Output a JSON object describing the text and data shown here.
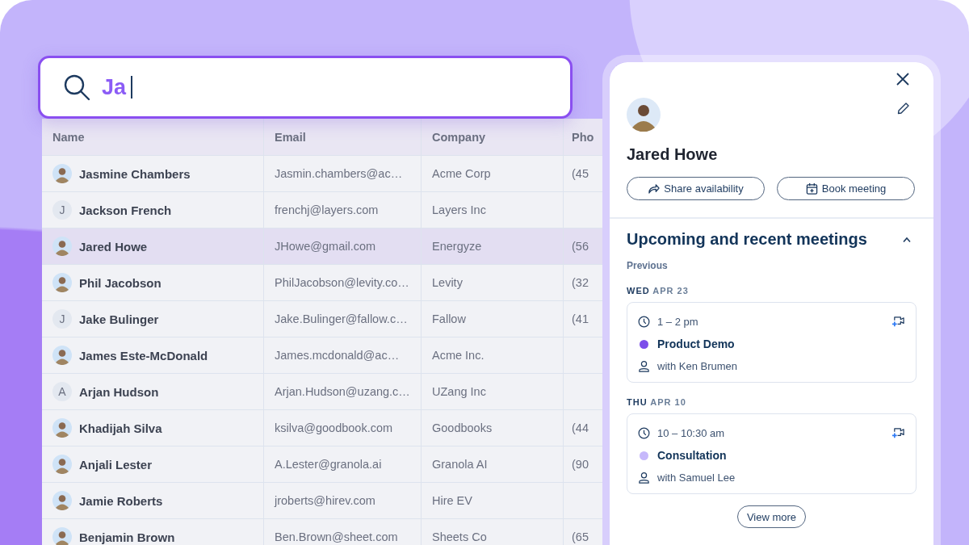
{
  "search": {
    "value": "Ja"
  },
  "table": {
    "columns": [
      "Name",
      "Email",
      "Company",
      "Pho"
    ],
    "rows": [
      {
        "avatar": {
          "kind": "photo"
        },
        "name": "Jasmine Chambers",
        "email": "Jasmin.chambers@ac…",
        "company": "Acme Corp",
        "phone": "(45",
        "selected": false
      },
      {
        "avatar": {
          "kind": "initial",
          "initial": "J"
        },
        "name": "Jackson French",
        "email": "frenchj@layers.com",
        "company": "Layers Inc",
        "selected": false
      },
      {
        "avatar": {
          "kind": "photo"
        },
        "name": "Jared Howe",
        "email": "JHowe@gmail.com",
        "company": "Energyze",
        "phone": "(56",
        "selected": true
      },
      {
        "avatar": {
          "kind": "photo"
        },
        "name": "Phil Jacobson",
        "email": "PhilJacobson@levity.co…",
        "company": "Levity",
        "phone": "(32",
        "selected": false
      },
      {
        "avatar": {
          "kind": "initial",
          "initial": "J"
        },
        "name": "Jake Bulinger",
        "email": "Jake.Bulinger@fallow.c…",
        "company": "Fallow",
        "phone": "(41",
        "selected": false
      },
      {
        "avatar": {
          "kind": "photo"
        },
        "name": "James Este-McDonald",
        "email": "James.mcdonald@ac…",
        "company": "Acme Inc.",
        "selected": false
      },
      {
        "avatar": {
          "kind": "initial",
          "initial": "A"
        },
        "name": "Arjan Hudson",
        "email": "Arjan.Hudson@uzang.c…",
        "company": "UZang Inc",
        "selected": false
      },
      {
        "avatar": {
          "kind": "photo"
        },
        "name": "Khadijah Silva",
        "email": "ksilva@goodbook.com",
        "company": "Goodbooks",
        "phone": "(44",
        "selected": false
      },
      {
        "avatar": {
          "kind": "photo"
        },
        "name": "Anjali Lester",
        "email": "A.Lester@granola.ai",
        "company": "Granola AI",
        "phone": "(90",
        "selected": false
      },
      {
        "avatar": {
          "kind": "photo"
        },
        "name": "Jamie Roberts",
        "email": "jroberts@hirev.com",
        "company": "Hire EV",
        "selected": false
      },
      {
        "avatar": {
          "kind": "photo"
        },
        "name": "Benjamin Brown",
        "email": "Ben.Brown@sheet.com",
        "company": "Sheets Co",
        "phone": "(65",
        "selected": false
      }
    ]
  },
  "contact_panel": {
    "name": "Jared Howe",
    "actions": [
      {
        "kind": "share",
        "label": "Share availability"
      },
      {
        "kind": "book",
        "label": "Book meeting"
      }
    ],
    "meetings": {
      "title": "Upcoming and recent meetings",
      "expanded": true,
      "subtitle": "Previous",
      "days": [
        {
          "weekday": "WED",
          "date": "APR 23",
          "meetings": [
            {
              "time": "1 – 2 pm",
              "title": "Product Demo",
              "color": "#7c4dea",
              "attendee": "with Ken Brumen"
            }
          ]
        },
        {
          "weekday": "THU",
          "date": "APR 10",
          "meetings": [
            {
              "time": "10 – 10:30 am",
              "title": "Consultation",
              "color": "#c6b8fb",
              "attendee": "with Samuel Lee"
            }
          ]
        }
      ],
      "more_button": "View more"
    }
  }
}
